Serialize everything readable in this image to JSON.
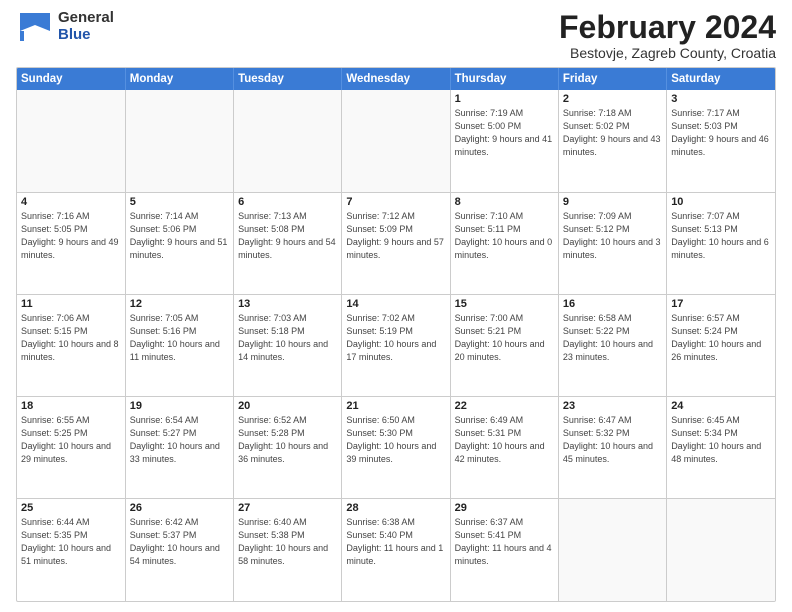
{
  "logo": {
    "general": "General",
    "blue": "Blue"
  },
  "title": "February 2024",
  "subtitle": "Bestovje, Zagreb County, Croatia",
  "days_header": [
    "Sunday",
    "Monday",
    "Tuesday",
    "Wednesday",
    "Thursday",
    "Friday",
    "Saturday"
  ],
  "weeks": [
    [
      {
        "num": "",
        "info": ""
      },
      {
        "num": "",
        "info": ""
      },
      {
        "num": "",
        "info": ""
      },
      {
        "num": "",
        "info": ""
      },
      {
        "num": "1",
        "info": "Sunrise: 7:19 AM\nSunset: 5:00 PM\nDaylight: 9 hours\nand 41 minutes."
      },
      {
        "num": "2",
        "info": "Sunrise: 7:18 AM\nSunset: 5:02 PM\nDaylight: 9 hours\nand 43 minutes."
      },
      {
        "num": "3",
        "info": "Sunrise: 7:17 AM\nSunset: 5:03 PM\nDaylight: 9 hours\nand 46 minutes."
      }
    ],
    [
      {
        "num": "4",
        "info": "Sunrise: 7:16 AM\nSunset: 5:05 PM\nDaylight: 9 hours\nand 49 minutes."
      },
      {
        "num": "5",
        "info": "Sunrise: 7:14 AM\nSunset: 5:06 PM\nDaylight: 9 hours\nand 51 minutes."
      },
      {
        "num": "6",
        "info": "Sunrise: 7:13 AM\nSunset: 5:08 PM\nDaylight: 9 hours\nand 54 minutes."
      },
      {
        "num": "7",
        "info": "Sunrise: 7:12 AM\nSunset: 5:09 PM\nDaylight: 9 hours\nand 57 minutes."
      },
      {
        "num": "8",
        "info": "Sunrise: 7:10 AM\nSunset: 5:11 PM\nDaylight: 10 hours\nand 0 minutes."
      },
      {
        "num": "9",
        "info": "Sunrise: 7:09 AM\nSunset: 5:12 PM\nDaylight: 10 hours\nand 3 minutes."
      },
      {
        "num": "10",
        "info": "Sunrise: 7:07 AM\nSunset: 5:13 PM\nDaylight: 10 hours\nand 6 minutes."
      }
    ],
    [
      {
        "num": "11",
        "info": "Sunrise: 7:06 AM\nSunset: 5:15 PM\nDaylight: 10 hours\nand 8 minutes."
      },
      {
        "num": "12",
        "info": "Sunrise: 7:05 AM\nSunset: 5:16 PM\nDaylight: 10 hours\nand 11 minutes."
      },
      {
        "num": "13",
        "info": "Sunrise: 7:03 AM\nSunset: 5:18 PM\nDaylight: 10 hours\nand 14 minutes."
      },
      {
        "num": "14",
        "info": "Sunrise: 7:02 AM\nSunset: 5:19 PM\nDaylight: 10 hours\nand 17 minutes."
      },
      {
        "num": "15",
        "info": "Sunrise: 7:00 AM\nSunset: 5:21 PM\nDaylight: 10 hours\nand 20 minutes."
      },
      {
        "num": "16",
        "info": "Sunrise: 6:58 AM\nSunset: 5:22 PM\nDaylight: 10 hours\nand 23 minutes."
      },
      {
        "num": "17",
        "info": "Sunrise: 6:57 AM\nSunset: 5:24 PM\nDaylight: 10 hours\nand 26 minutes."
      }
    ],
    [
      {
        "num": "18",
        "info": "Sunrise: 6:55 AM\nSunset: 5:25 PM\nDaylight: 10 hours\nand 29 minutes."
      },
      {
        "num": "19",
        "info": "Sunrise: 6:54 AM\nSunset: 5:27 PM\nDaylight: 10 hours\nand 33 minutes."
      },
      {
        "num": "20",
        "info": "Sunrise: 6:52 AM\nSunset: 5:28 PM\nDaylight: 10 hours\nand 36 minutes."
      },
      {
        "num": "21",
        "info": "Sunrise: 6:50 AM\nSunset: 5:30 PM\nDaylight: 10 hours\nand 39 minutes."
      },
      {
        "num": "22",
        "info": "Sunrise: 6:49 AM\nSunset: 5:31 PM\nDaylight: 10 hours\nand 42 minutes."
      },
      {
        "num": "23",
        "info": "Sunrise: 6:47 AM\nSunset: 5:32 PM\nDaylight: 10 hours\nand 45 minutes."
      },
      {
        "num": "24",
        "info": "Sunrise: 6:45 AM\nSunset: 5:34 PM\nDaylight: 10 hours\nand 48 minutes."
      }
    ],
    [
      {
        "num": "25",
        "info": "Sunrise: 6:44 AM\nSunset: 5:35 PM\nDaylight: 10 hours\nand 51 minutes."
      },
      {
        "num": "26",
        "info": "Sunrise: 6:42 AM\nSunset: 5:37 PM\nDaylight: 10 hours\nand 54 minutes."
      },
      {
        "num": "27",
        "info": "Sunrise: 6:40 AM\nSunset: 5:38 PM\nDaylight: 10 hours\nand 58 minutes."
      },
      {
        "num": "28",
        "info": "Sunrise: 6:38 AM\nSunset: 5:40 PM\nDaylight: 11 hours\nand 1 minute."
      },
      {
        "num": "29",
        "info": "Sunrise: 6:37 AM\nSunset: 5:41 PM\nDaylight: 11 hours\nand 4 minutes."
      },
      {
        "num": "",
        "info": ""
      },
      {
        "num": "",
        "info": ""
      }
    ]
  ]
}
